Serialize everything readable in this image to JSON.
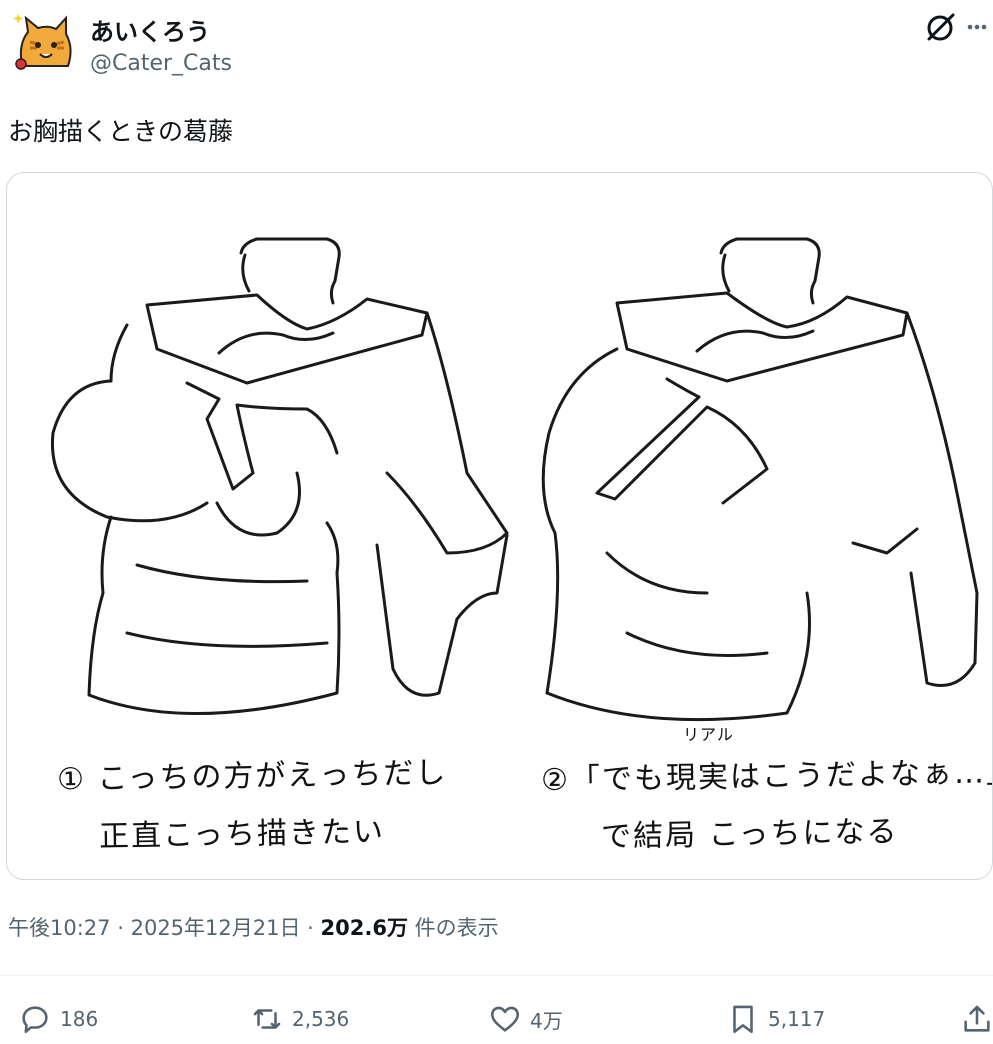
{
  "author": {
    "display_name": "あいくろう",
    "handle": "@Cater_Cats",
    "avatar_icon": "cat-avatar-icon"
  },
  "header_actions": {
    "grok_icon": "grok-icon",
    "more_icon": "more-dots-icon"
  },
  "post": {
    "text": "お胸描くときの葛藤"
  },
  "media": {
    "caption_left_line1": "① こっちの方がえっちだし",
    "caption_left_line2": "正直こっち描きたい",
    "caption_right_line1": "②「でも現実はこうだよなぁ…」",
    "caption_right_ruby": "リアル",
    "caption_right_line2": "で結局 こっちになる"
  },
  "meta": {
    "time": "午後10:27",
    "separator": "·",
    "date": "2025年12月21日",
    "views_count": "202.6万",
    "views_label": "件の表示"
  },
  "actions": {
    "replies": "186",
    "reposts": "2,536",
    "likes": "4万",
    "bookmarks": "5,117"
  },
  "colors": {
    "text_primary": "#0f1419",
    "text_secondary": "#536471",
    "border": "#cfd9de",
    "divider": "#eff3f4"
  }
}
